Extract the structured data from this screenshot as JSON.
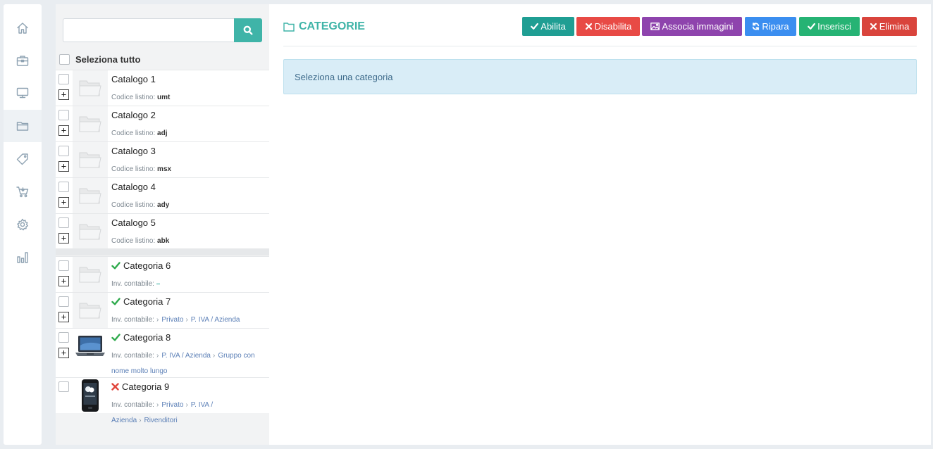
{
  "nav": {
    "items": [
      {
        "icon": "home-icon",
        "active": false
      },
      {
        "icon": "briefcase-icon",
        "active": false
      },
      {
        "icon": "monitor-icon",
        "active": false
      },
      {
        "icon": "folder-icon",
        "active": true
      },
      {
        "icon": "tag-icon",
        "active": false
      },
      {
        "icon": "cart-icon",
        "active": false
      },
      {
        "icon": "gear-icon",
        "active": false
      },
      {
        "icon": "bar-chart-icon",
        "active": false
      }
    ]
  },
  "sidebar": {
    "search": {
      "value": "",
      "placeholder": ""
    },
    "select_all_label": "Seleziona tutto",
    "catalogs": [
      {
        "title": "Catalogo 1",
        "code_label": "Codice listino:",
        "code": "umt"
      },
      {
        "title": "Catalogo 2",
        "code_label": "Codice listino:",
        "code": "adj"
      },
      {
        "title": "Catalogo 3",
        "code_label": "Codice listino:",
        "code": "msx"
      },
      {
        "title": "Catalogo 4",
        "code_label": "Codice listino:",
        "code": "ady"
      },
      {
        "title": "Catalogo 5",
        "code_label": "Codice listino:",
        "code": "abk"
      }
    ],
    "categories": [
      {
        "title": "Categoria 6",
        "status": "enabled",
        "inv_label": "Inv. contabile:",
        "inv_dash": "–"
      },
      {
        "title": "Categoria 7",
        "status": "enabled",
        "inv_label": "Inv. contabile:",
        "path": [
          "Privato",
          "P. IVA / Azienda"
        ]
      },
      {
        "title": "Categoria 8",
        "status": "enabled",
        "inv_label": "Inv. contabile:",
        "path": [
          "P. IVA / Azienda",
          "Gruppo con nome molto lungo"
        ]
      },
      {
        "title": "Categoria 9",
        "status": "disabled",
        "inv_label": "Inv. contabile:",
        "path": [
          "Privato",
          "P. IVA / Azienda",
          "Rivenditori"
        ]
      }
    ]
  },
  "main": {
    "title": "CATEGORIE",
    "toolbar": {
      "enable": {
        "label": "Abilita",
        "color": "#1f9e93"
      },
      "disable": {
        "label": "Disabilita",
        "color": "#e84a45"
      },
      "images": {
        "label": "Associa immagini",
        "color": "#8e44ad"
      },
      "repair": {
        "label": "Ripara",
        "color": "#3b8ef0"
      },
      "insert": {
        "label": "Inserisci",
        "color": "#26b374"
      },
      "delete": {
        "label": "Elimina",
        "color": "#d9443c"
      }
    },
    "alert": "Seleziona una categoria"
  },
  "colors": {
    "accent": "#3fb4a8",
    "check_green": "#2eaa4c",
    "cross_red": "#e0463c",
    "link": "#5b7fb6"
  }
}
